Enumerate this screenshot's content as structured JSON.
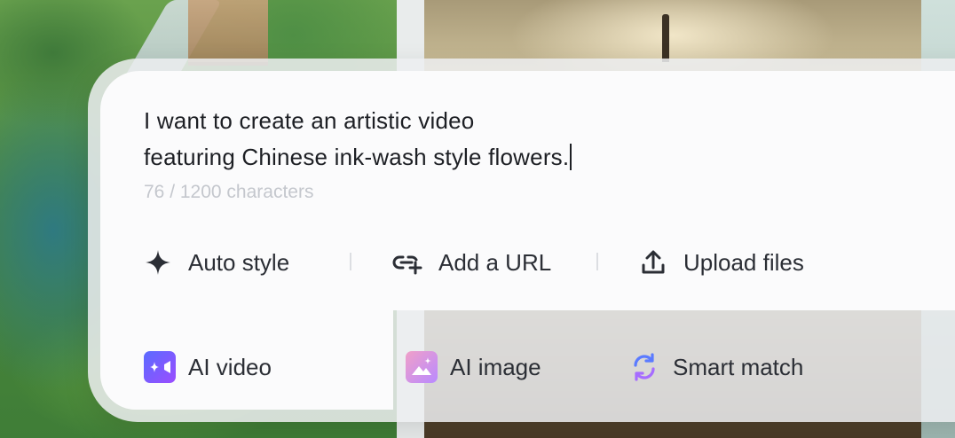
{
  "prompt": {
    "text": "I want to create an artistic video\nfeaturing Chinese ink-wash style flowers.",
    "counter": "76 / 1200 characters"
  },
  "tools": {
    "auto_style": "Auto style",
    "add_url": "Add a URL",
    "upload_files": "Upload files"
  },
  "modes": {
    "ai_video": "AI video",
    "ai_image": "AI image",
    "smart_match": "Smart match",
    "active": "AI video"
  },
  "icons": {
    "auto_style": "sparkle-icon",
    "add_url": "link-add-icon",
    "upload_files": "upload-icon",
    "ai_video": "video-camera-icon",
    "ai_image": "image-icon",
    "smart_match": "refresh-icon"
  },
  "colors": {
    "text": "#1d1f24",
    "muted": "#c4c7cd",
    "video_icon": "#7b4dff",
    "image_icon": "#e07ab8",
    "match_icon": "#5b7bff"
  }
}
